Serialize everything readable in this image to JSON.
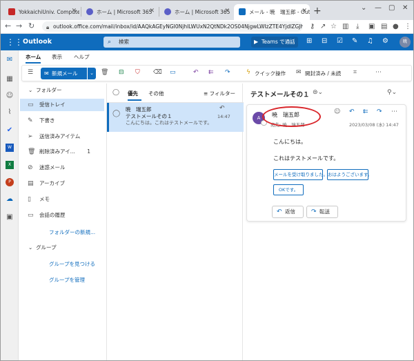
{
  "browser": {
    "tabs": [
      {
        "title": "YokkaichiUniv. Compute",
        "color": "#c62828"
      },
      {
        "title": "ホーム | Microsoft 365",
        "color": "#5b5fc7"
      },
      {
        "title": "ホーム | Microsoft 365",
        "color": "#5b5fc7"
      },
      {
        "title": "メール - 暁　瑞五郎 - Out",
        "color": "#0f6cbd"
      }
    ],
    "url": "outlook.office.com/mail/inbox/id/AAQkAGEyNGI0NjhlLWUxN2QtNDk2OS04NjgwLWIzZTE4YjdlZGJhY..."
  },
  "header": {
    "brand": "Outlook",
    "search_placeholder": "検索",
    "teams_label": "Teams で通話",
    "avatar": "暁"
  },
  "ribbon": {
    "tabs": [
      "ホーム",
      "表示",
      "ヘルプ"
    ],
    "new_mail": "新規メール",
    "quick_steps": "クイック操作",
    "read_unread": "開封済み / 未読"
  },
  "folders": {
    "root": "フォルダー",
    "items": [
      {
        "label": "受信トレイ",
        "count": ""
      },
      {
        "label": "下書き",
        "count": ""
      },
      {
        "label": "送信済みアイテム",
        "count": ""
      },
      {
        "label": "削除済みアイ...",
        "count": "1"
      },
      {
        "label": "迷惑メール",
        "count": ""
      },
      {
        "label": "アーカイブ",
        "count": ""
      },
      {
        "label": "メモ",
        "count": ""
      },
      {
        "label": "会話の履歴",
        "count": ""
      }
    ],
    "new_folder": "フォルダーの新規...",
    "groups": "グループ",
    "find_groups": "グループを見つける",
    "manage_groups": "グループを管理"
  },
  "list": {
    "focused": "優先",
    "other": "その他",
    "filter": "フィルター",
    "message": {
      "sender": "暁　瑞五郎",
      "subject": "テストメールその１",
      "preview": "こんにちは。これはテストメールです。",
      "time": "14:47"
    }
  },
  "reading": {
    "subject": "テストメールその１",
    "sender": "暁　瑞五郎",
    "to_line": "宛先: 暁　瑞五郎",
    "date": "2023/03/08 (水) 14:47",
    "avatar": "A",
    "body": [
      "こんにちは。",
      "これはテストメールです。"
    ],
    "suggested_replies": [
      "メールを受け取りました。",
      "おはようございます。",
      "OKです。"
    ],
    "reply": "返信",
    "forward": "転送"
  },
  "colors": {
    "accent": "#0f6cbd",
    "selected": "#cfe4fa",
    "annotation": "#d9252a"
  }
}
